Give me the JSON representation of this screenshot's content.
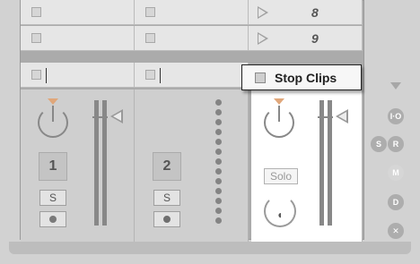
{
  "scenes": [
    {
      "number": "8"
    },
    {
      "number": "9"
    }
  ],
  "tooltip": {
    "label": "Stop Clips"
  },
  "tracks": [
    {
      "number": "1",
      "solo": "S"
    },
    {
      "number": "2",
      "solo": "S"
    }
  ],
  "master": {
    "solo": "Solo"
  },
  "side_buttons": {
    "io": "I·O",
    "s": "S",
    "r": "R",
    "m": "M",
    "d": "D",
    "x": "✕"
  },
  "colors": {
    "accent_orange": "#e0a77a",
    "panel_bg": "#d2d2d2",
    "tooltip_border": "#222222"
  }
}
